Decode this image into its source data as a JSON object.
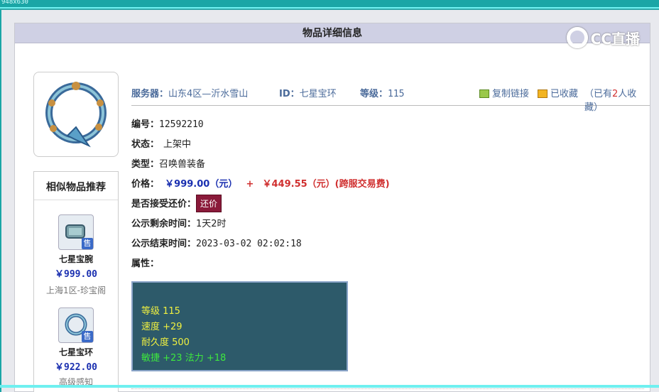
{
  "overlay": {
    "dims": "948x630"
  },
  "panel": {
    "title": "物品详细信息"
  },
  "logo": {
    "text": "CC直播"
  },
  "item": {
    "server_label": "服务器：",
    "server": "山东4区—沂水雪山",
    "id_label": "ID：",
    "id": "七星宝环",
    "level_label": "等级：",
    "level": "115",
    "copy_link": "复制链接",
    "favorited": "已收藏",
    "fav_count_pre": "（已有",
    "fav_count": "2",
    "fav_count_post": "人收藏）"
  },
  "details": {
    "number_label": "编号：",
    "number": "12592210",
    "status_label": "状态：",
    "status": "上架中",
    "type_label": "类型：",
    "type": "召唤兽装备",
    "price_label": "价格：",
    "price": "￥999.00（元）",
    "plus": "+",
    "fee": "￥449.55（元）(跨服交易费)",
    "bargain_label": "是否接受还价：",
    "bargain_btn": "还价",
    "remaining_label": "公示剩余时间：",
    "remaining": "1天2时",
    "end_label": "公示结束时间：",
    "end": "2023-03-02 02:02:18",
    "attr_label": "属性："
  },
  "attributes": {
    "line1": "等级 115",
    "line2": "速度 +29",
    "line3": "耐久度 500",
    "line4": "敏捷 +23 法力 +18"
  },
  "sidebar": {
    "title": "相似物品推荐",
    "items": [
      {
        "name": "七星宝腕",
        "price": "￥999.00",
        "server": "上海1区-珍宝阁",
        "badge": "售"
      },
      {
        "name": "七星宝环",
        "price": "￥922.00",
        "server": "高级感知",
        "badge": "售"
      }
    ]
  }
}
